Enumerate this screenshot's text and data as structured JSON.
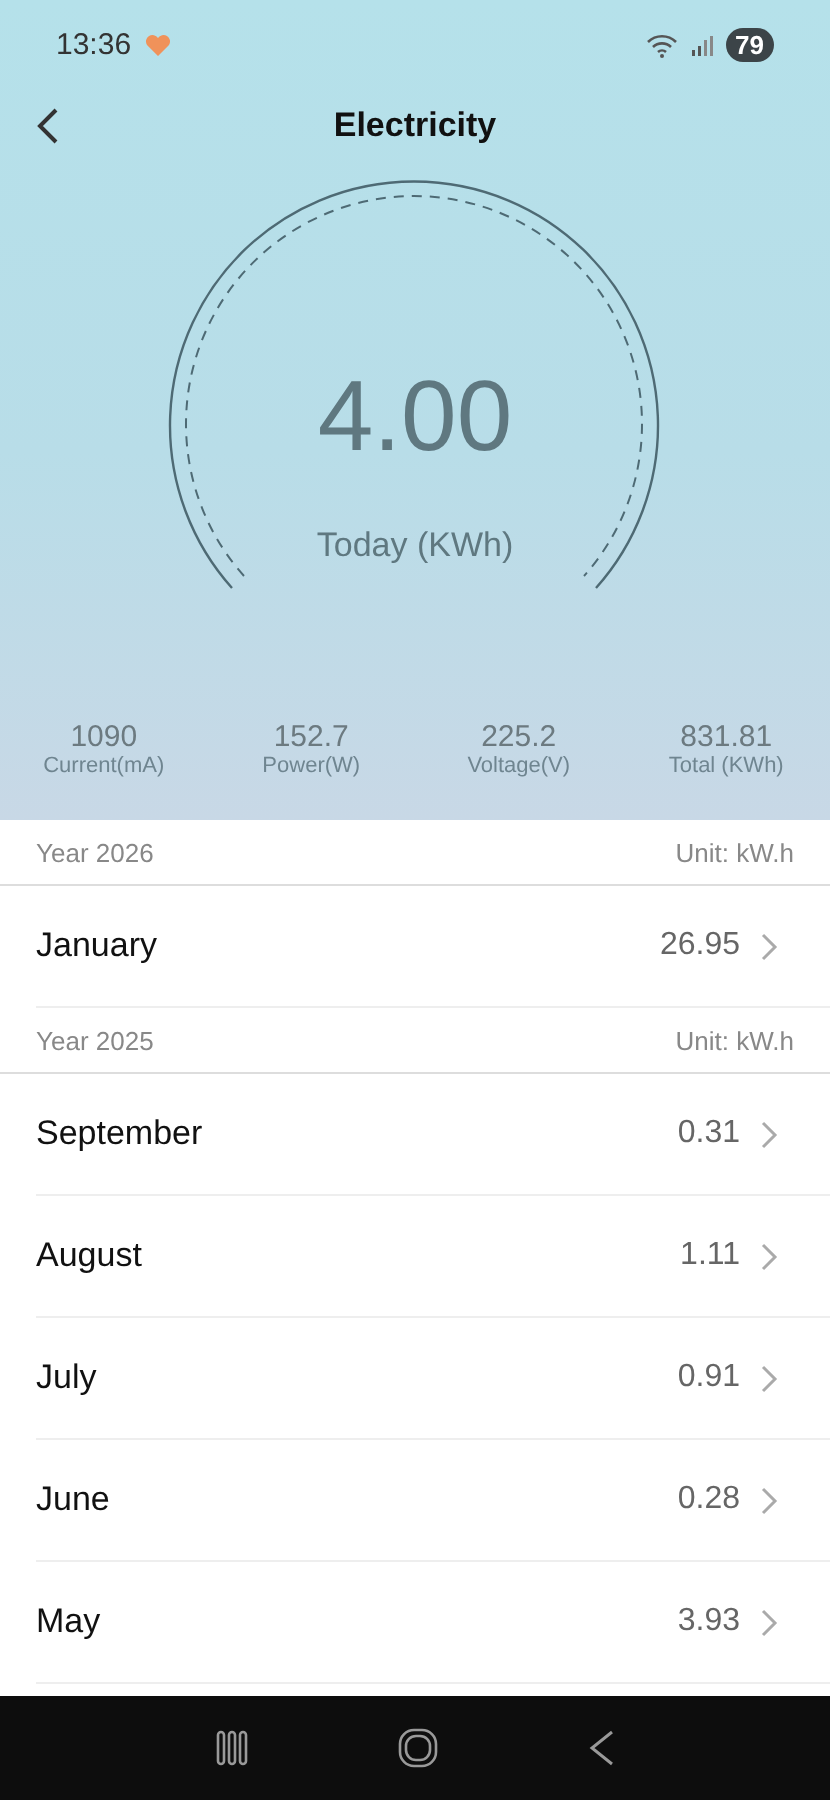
{
  "status_bar": {
    "time": "13:36",
    "battery": "79"
  },
  "header": {
    "title": "Electricity"
  },
  "gauge": {
    "value": "4.00",
    "label": "Today (KWh)"
  },
  "stats": [
    {
      "value": "1090",
      "label": "Current(mA)"
    },
    {
      "value": "152.7",
      "label": "Power(W)"
    },
    {
      "value": "225.2",
      "label": "Voltage(V)"
    },
    {
      "value": "831.81",
      "label": "Total (KWh)"
    }
  ],
  "years": [
    {
      "year": "Year 2026",
      "unit": "Unit: kW.h",
      "months": [
        {
          "month": "January",
          "value": "26.95"
        }
      ]
    },
    {
      "year": "Year 2025",
      "unit": "Unit: kW.h",
      "months": [
        {
          "month": "September",
          "value": "0.31"
        },
        {
          "month": "August",
          "value": "1.11"
        },
        {
          "month": "July",
          "value": "0.91"
        },
        {
          "month": "June",
          "value": "0.28"
        },
        {
          "month": "May",
          "value": "3.93"
        }
      ]
    }
  ]
}
